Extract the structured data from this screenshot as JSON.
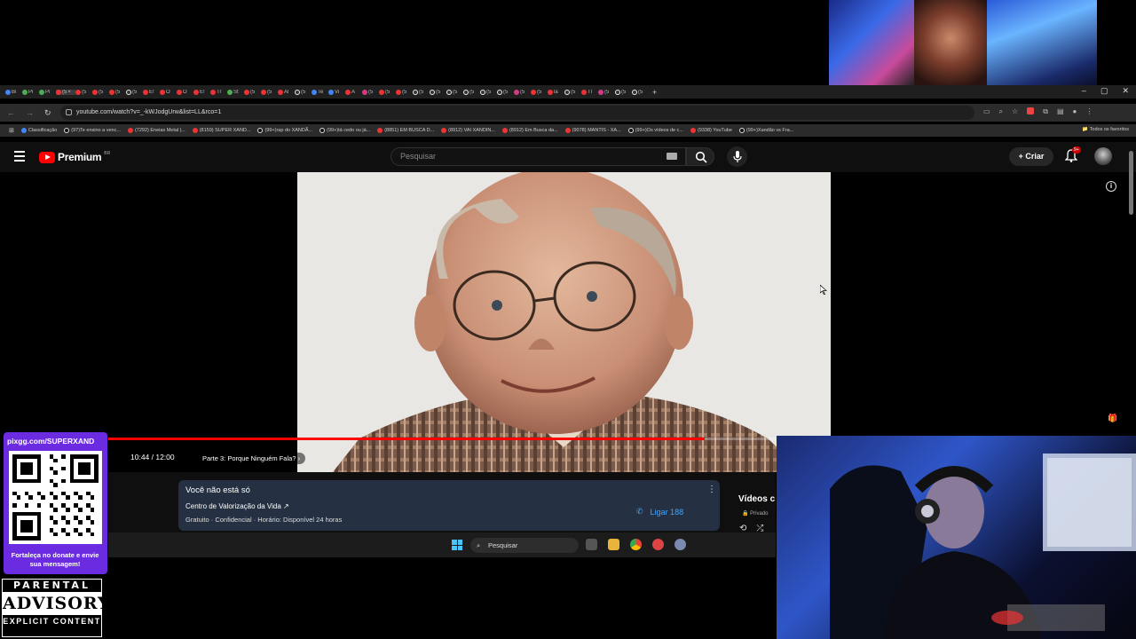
{
  "browser": {
    "url": "youtube.com/watch?v=_-kWJodgUrw&list=LL&rco=1",
    "tabs": [
      {
        "label": "Bi",
        "kind": "b"
      },
      {
        "label": "Pi",
        "kind": "g"
      },
      {
        "label": "Pi",
        "kind": "g"
      },
      {
        "label": "(5",
        "kind": "r",
        "active": true
      },
      {
        "label": "(5",
        "kind": "r"
      },
      {
        "label": "(5",
        "kind": "r"
      },
      {
        "label": "(5",
        "kind": "r"
      },
      {
        "label": "(5",
        "kind": "t"
      },
      {
        "label": "E!",
        "kind": "r"
      },
      {
        "label": "O",
        "kind": "r"
      },
      {
        "label": "O",
        "kind": "r"
      },
      {
        "label": "E!",
        "kind": "r"
      },
      {
        "label": "Tr",
        "kind": "r"
      },
      {
        "label": "St",
        "kind": "g"
      },
      {
        "label": "(5",
        "kind": "r"
      },
      {
        "label": "(5",
        "kind": "r"
      },
      {
        "label": "Al",
        "kind": "r"
      },
      {
        "label": "(5",
        "kind": "t"
      },
      {
        "label": "Te",
        "kind": "b"
      },
      {
        "label": "Vi",
        "kind": "b"
      },
      {
        "label": "A",
        "kind": "r"
      },
      {
        "label": "(5",
        "kind": "i"
      },
      {
        "label": "(5",
        "kind": "r"
      },
      {
        "label": "(5",
        "kind": "r"
      },
      {
        "label": "(5",
        "kind": "t"
      },
      {
        "label": "(5",
        "kind": "t"
      },
      {
        "label": "(5",
        "kind": "t"
      },
      {
        "label": "(5",
        "kind": "t"
      },
      {
        "label": "(5",
        "kind": "t"
      },
      {
        "label": "(5",
        "kind": "t"
      },
      {
        "label": "(5",
        "kind": "i"
      },
      {
        "label": "(5",
        "kind": "r"
      },
      {
        "label": "la",
        "kind": "r"
      },
      {
        "label": "(5",
        "kind": "t"
      },
      {
        "label": "Tl",
        "kind": "r"
      },
      {
        "label": "(5",
        "kind": "i"
      },
      {
        "label": "(5",
        "kind": "t"
      },
      {
        "label": "(5",
        "kind": "t"
      }
    ],
    "new_tab": "+",
    "bookmarks": [
      {
        "label": "Classificação",
        "kind": "b"
      },
      {
        "label": "(97)Te ensino a venc...",
        "kind": "t"
      },
      {
        "label": "(7292) Eneias Metal |...",
        "kind": "r"
      },
      {
        "label": "(8159) SUPER XAND...",
        "kind": "r"
      },
      {
        "label": "(99+)rap do XANDÃ...",
        "kind": "t"
      },
      {
        "label": "(99+)tá cedo ou já...",
        "kind": "t"
      },
      {
        "label": "(8851) EM BUSCA D...",
        "kind": "r"
      },
      {
        "label": "(8912) VAI XANDIN...",
        "kind": "r"
      },
      {
        "label": "(8912) Em Busca da...",
        "kind": "r"
      },
      {
        "label": "(9078) MANTIS - XA...",
        "kind": "r"
      },
      {
        "label": "(99+)Os vídeos de c...",
        "kind": "t"
      },
      {
        "label": "(9338) YouTube",
        "kind": "r"
      },
      {
        "label": "(99+)Xandão vs Fra...",
        "kind": "t"
      }
    ],
    "all_bookmarks": "Todos os favoritos"
  },
  "youtube": {
    "logo_text": "Premium",
    "region": "BR",
    "search_placeholder": "Pesquisar",
    "create_label": "Criar",
    "notifications": "9+",
    "player": {
      "current_time": "10:44 / 12:00",
      "chapter": "Parte 3: Porque Ninguém Fala?",
      "progress": 0.894
    },
    "help_card": {
      "title": "Você não está só",
      "link": "Centro de Valorização da Vida ↗",
      "meta": "Gratuito · Confidencial · Horário: Disponível 24 horas",
      "call": "Ligar 188"
    },
    "side": {
      "title": "Vídeos c",
      "subtitle": "Privado"
    }
  },
  "taskbar": {
    "search_placeholder": "Pesquisar"
  },
  "overlay": {
    "donate_url": "pixgg.com/SUPERXAND",
    "donate_text": "Fortaleça no donate e envie sua mensagem!",
    "advisory_top": "PARENTAL",
    "advisory_mid": "ADVISORY",
    "advisory_bot": "EXPLICIT CONTENT"
  },
  "colors": {
    "yt_red": "#ff0000",
    "link_blue": "#3ea6ff",
    "donate_purple": "#6b2be0"
  }
}
